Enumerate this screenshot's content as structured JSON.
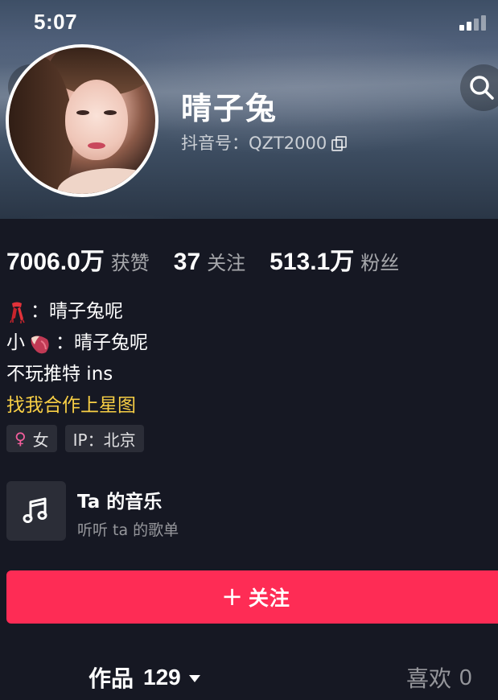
{
  "status_bar": {
    "time": "5:07"
  },
  "profile": {
    "name": "晴子兔",
    "douyin_id": "抖音号：QZT2000"
  },
  "stats": [
    {
      "value": "7006.0万",
      "label": "获赞"
    },
    {
      "value": "37",
      "label": "关注"
    },
    {
      "value": "513.1万",
      "label": "粉丝"
    }
  ],
  "bio": {
    "line1_text": "：晴子兔呢",
    "line2_prefix": "小",
    "line2_text": "：晴子兔呢",
    "line3": "不玩推特 ins",
    "link": "找我合作上星图"
  },
  "tags": {
    "gender": "女",
    "ip": "IP：北京"
  },
  "music": {
    "title": "Ta 的音乐",
    "subtitle": "听听 ta 的歌单"
  },
  "follow_button": {
    "label": "关注"
  },
  "tabs": {
    "works_label": "作品",
    "works_count": "129",
    "likes_label": "喜欢",
    "likes_count": "0"
  },
  "colors": {
    "background": "#161823",
    "accent": "#fe2c55",
    "link": "#f8cf45",
    "female": "#f35e9c"
  }
}
